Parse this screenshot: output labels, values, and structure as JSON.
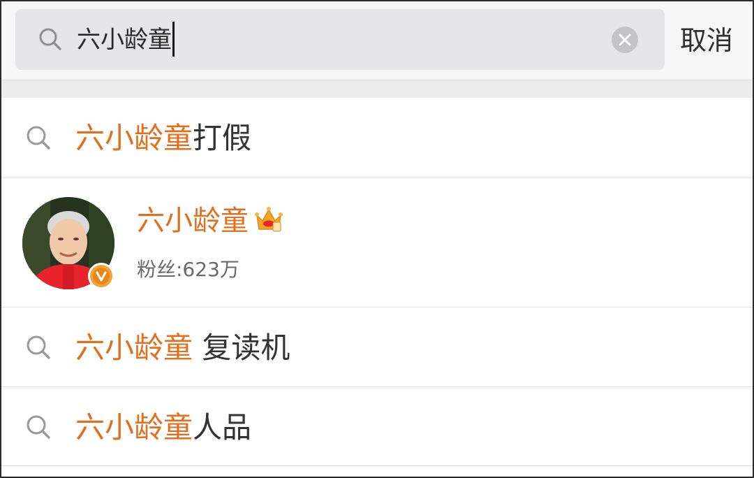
{
  "search": {
    "query": "六小龄童",
    "cancel_label": "取消"
  },
  "suggestions": [
    {
      "highlight": "六小龄童",
      "rest": "打假"
    },
    {
      "highlight": "六小龄童",
      "rest": " 复读机"
    },
    {
      "highlight": "六小龄童",
      "rest": "人品"
    }
  ],
  "user_result": {
    "name": "六小龄童",
    "followers": "粉丝:623万",
    "badge_icon": "crown-icon",
    "verified_icon": "verified-v-icon"
  },
  "colors": {
    "highlight": "#e06f1f",
    "search_box": "#e6e6e8",
    "background": "#ffffff"
  }
}
